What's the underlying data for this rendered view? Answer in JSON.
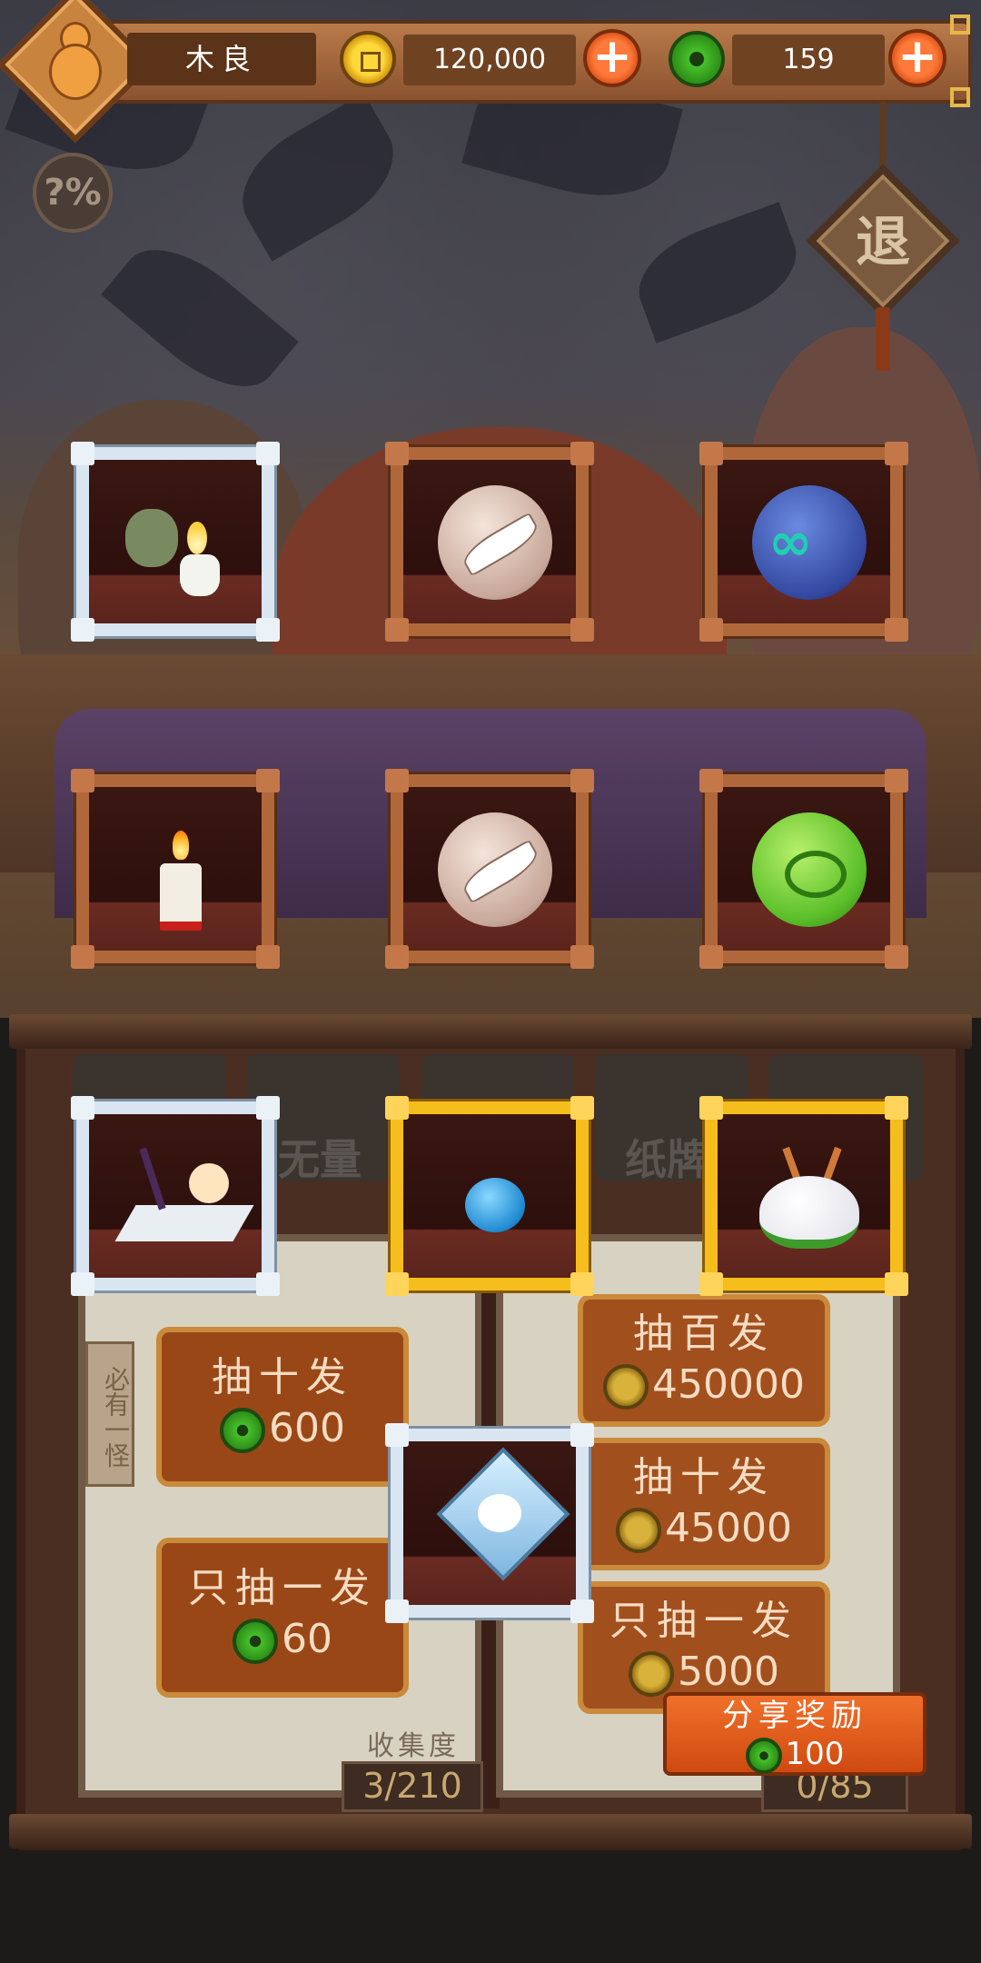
{
  "player": {
    "name": "木良"
  },
  "currency": {
    "coins": "120,000",
    "jade": "159"
  },
  "ui": {
    "exit_label": "退",
    "odds_label": "?%",
    "tag_label": "必有一怪",
    "tabs": [
      "无量",
      "纸牌"
    ]
  },
  "left_panel": {
    "draw_ten": {
      "label": "抽十发",
      "price": "600"
    },
    "draw_one": {
      "label": "只抽一发",
      "price": "60"
    },
    "collection_label": "收集度",
    "collection_value": "3/210"
  },
  "right_panel": {
    "draw_hundred": {
      "label": "抽百发",
      "price": "450000"
    },
    "draw_ten": {
      "label": "抽十发",
      "price": "45000"
    },
    "draw_one": {
      "label": "只抽一发",
      "price": "5000"
    },
    "collection_value": "0/85"
  },
  "share": {
    "label": "分享奖励",
    "price": "100"
  },
  "colors": {
    "accent_orange": "#e8602a",
    "gold_frame": "#f6be1c",
    "silver_frame": "#d9e6f2",
    "wood_frame": "#b0683b"
  },
  "cards": [
    {
      "frame": "silver",
      "item": "imp-with-lamp"
    },
    {
      "frame": "wood",
      "item": "feather-orb"
    },
    {
      "frame": "wood",
      "item": "infinity-orb"
    },
    {
      "frame": "wood",
      "item": "candle"
    },
    {
      "frame": "wood",
      "item": "feather-orb"
    },
    {
      "frame": "wood",
      "item": "swirl-orb"
    },
    {
      "frame": "silver",
      "item": "calligrapher"
    },
    {
      "frame": "gold",
      "item": "water-spirit"
    },
    {
      "frame": "gold",
      "item": "white-deer"
    },
    {
      "frame": "silver",
      "item": "crystal-spirit"
    }
  ]
}
